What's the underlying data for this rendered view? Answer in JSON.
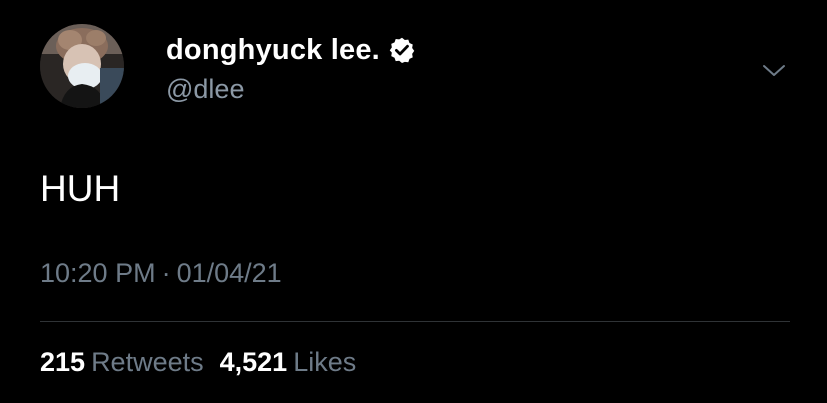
{
  "tweet": {
    "author": {
      "display_name": "donghyuck lee.",
      "handle": "@dlee",
      "verified": true
    },
    "text": "HUH",
    "time": "10:20 PM",
    "separator": "·",
    "date": "01/04/21",
    "stats": {
      "retweets_count": "215",
      "retweets_label": "Retweets",
      "likes_count": "4,521",
      "likes_label": "Likes"
    }
  },
  "icons": {
    "verified": "verified-badge-icon",
    "menu": "chevron-down-icon"
  },
  "colors": {
    "background": "#000000",
    "primary_text": "#ffffff",
    "secondary_text": "#8b98a5",
    "muted_text": "#6e7b88",
    "divider": "#2f3336"
  }
}
